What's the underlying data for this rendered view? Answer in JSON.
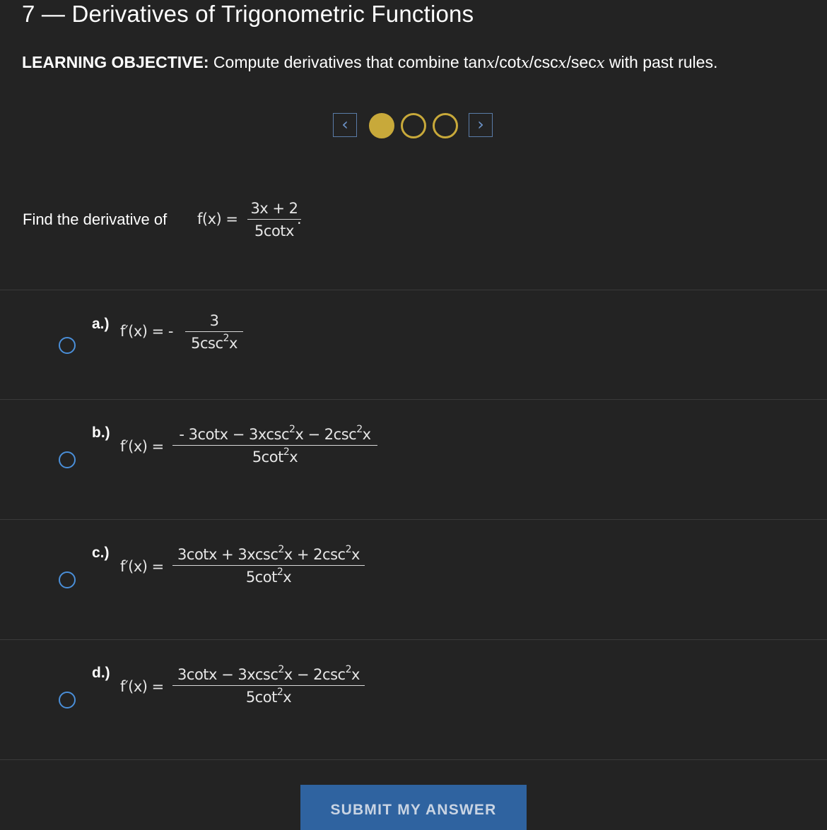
{
  "header": {
    "title": "7 — Derivatives of Trigonometric Functions",
    "objective_label": "LEARNING OBJECTIVE:",
    "objective_pre": " Compute derivatives that combine tan",
    "objective_x1": "x",
    "objective_sep1": "/cot",
    "objective_x2": "x",
    "objective_sep2": "/csc",
    "objective_x3": "x",
    "objective_sep3": "/sec",
    "objective_x4": "x",
    "objective_post": " with past rules."
  },
  "pager": {
    "prev_icon": "chevron-left-icon",
    "prev_glyph": "‹",
    "next_icon": "chevron-right-icon",
    "next_glyph": "›",
    "current_page": 1,
    "total_pages": 3,
    "accent_color": "#c8a93a",
    "nav_color": "#6c93c8"
  },
  "question": {
    "prompt": "Find the derivative of ",
    "fx": "f(x) =",
    "numerator": "3x + 2",
    "denominator": "5cotx",
    "end": "."
  },
  "options": [
    {
      "letter": "a.)",
      "lhs": "f′(x) = -",
      "numerator": "3",
      "den_a": "5csc",
      "den_sup": "2",
      "den_b": "x"
    },
    {
      "letter": "b.)",
      "lhs": "f′(x) =",
      "num_a": "- 3cotx − 3xcsc",
      "num_sup1": "2",
      "num_b": "x − 2csc",
      "num_sup2": "2",
      "num_c": "x",
      "den_a": "5cot",
      "den_sup": "2",
      "den_b": "x"
    },
    {
      "letter": "c.)",
      "lhs": "f′(x) =",
      "num_a": "3cotx + 3xcsc",
      "num_sup1": "2",
      "num_b": "x + 2csc",
      "num_sup2": "2",
      "num_c": "x",
      "den_a": "5cot",
      "den_sup": "2",
      "den_b": "x"
    },
    {
      "letter": "d.)",
      "lhs": "f′(x) =",
      "num_a": "3cotx − 3xcsc",
      "num_sup1": "2",
      "num_b": "x − 2csc",
      "num_sup2": "2",
      "num_c": "x",
      "den_a": "5cot",
      "den_sup": "2",
      "den_b": "x"
    }
  ],
  "submit": {
    "label": "SUBMIT MY ANSWER",
    "color": "#2f63a0"
  }
}
